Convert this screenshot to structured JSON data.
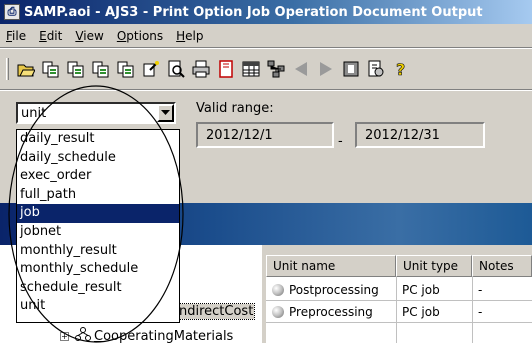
{
  "window": {
    "title": "SAMP.aoi - AJS3 - Print Option Job Operation Document Output",
    "app_icon": "document-print-icon"
  },
  "menu": [
    {
      "label": "File",
      "key": "F",
      "rest": "ile"
    },
    {
      "label": "Edit",
      "key": "E",
      "rest": "dit"
    },
    {
      "label": "View",
      "key": "V",
      "rest": "iew"
    },
    {
      "label": "Options",
      "key": "O",
      "rest": "ptions"
    },
    {
      "label": "Help",
      "key": "H",
      "rest": "elp"
    }
  ],
  "toolbar": {
    "buttons": [
      "open-folder-icon",
      "multi-page-icon",
      "multi-page-2-icon",
      "multi-page-3-icon",
      "multi-page-4-icon",
      "wizard-icon",
      "print-preview-icon",
      "printer-icon",
      "book-icon",
      "grid-icon",
      "tree-icon",
      "prev-arrow-icon",
      "next-arrow-icon",
      "info-icon",
      "settings-icon",
      "help-icon"
    ]
  },
  "options": {
    "selected_value": "unit",
    "valid_range_label": "Valid range:",
    "date_from": "2012/12/1",
    "date_separator": "-",
    "date_to": "2012/12/31"
  },
  "dropdown_list": {
    "items": [
      "daily_result",
      "daily_schedule",
      "exec_order",
      "full_path",
      "job",
      "jobnet",
      "monthly_result",
      "monthly_schedule",
      "schedule_result",
      "unit"
    ],
    "highlighted": "job"
  },
  "tree": {
    "visible_text": "ndirectCost",
    "node_cooperating": {
      "prefix": "C",
      "rest": "ooperatingMaterials"
    }
  },
  "table": {
    "columns": [
      "Unit name",
      "Unit type",
      "Notes"
    ],
    "rows": [
      {
        "name": "Postprocessing",
        "type": "PC job",
        "notes": "-"
      },
      {
        "name": "Preprocessing",
        "type": "PC job",
        "notes": "-"
      }
    ]
  },
  "colors": {
    "title_bar": "#0a246a",
    "selection": "#0a246a",
    "window_face": "#d4d0c8"
  }
}
